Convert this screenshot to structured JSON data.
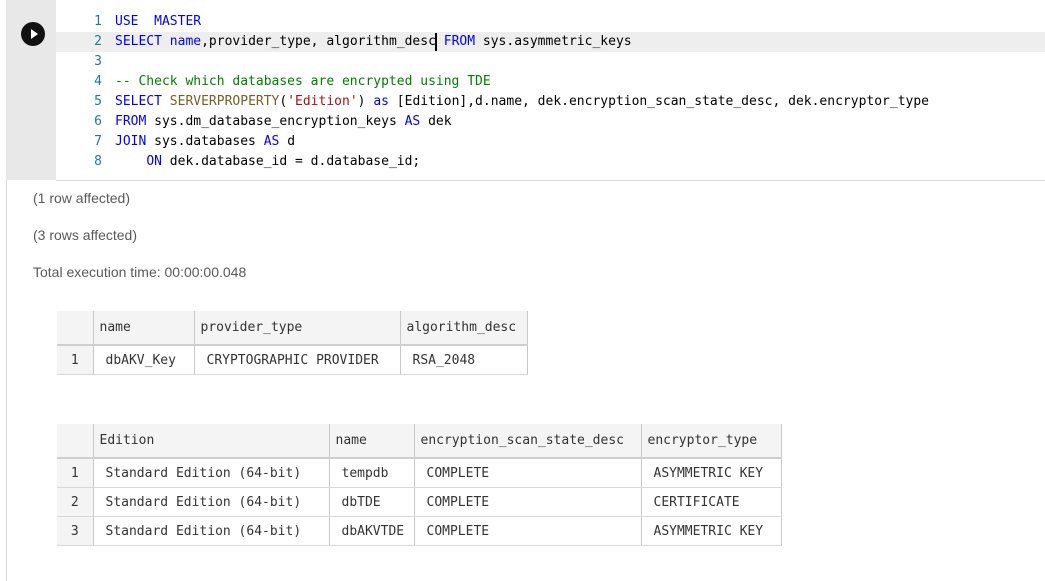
{
  "editor": {
    "lines": [
      {
        "num": "1",
        "parts": [
          [
            "kw",
            "USE"
          ],
          [
            "",
            "  "
          ],
          [
            "kw",
            "MASTER"
          ]
        ]
      },
      {
        "num": "2",
        "parts": [
          [
            "kw",
            "SELECT"
          ],
          [
            "",
            " "
          ],
          [
            "kw",
            "name"
          ],
          [
            "",
            ",provider_type, algorithm_desc"
          ],
          [
            "caret",
            ""
          ],
          [
            "",
            ""
          ],
          [
            "kw",
            " FROM"
          ],
          [
            "",
            " sys.asymmetric_keys"
          ]
        ]
      },
      {
        "num": "3",
        "parts": []
      },
      {
        "num": "4",
        "parts": [
          [
            "cm",
            "-- Check which databases are encrypted using TDE"
          ]
        ]
      },
      {
        "num": "5",
        "parts": [
          [
            "kw",
            "SELECT"
          ],
          [
            "",
            " "
          ],
          [
            "fn",
            "SERVERPROPERTY"
          ],
          [
            "",
            "("
          ],
          [
            "str",
            "'Edition'"
          ],
          [
            "",
            ") "
          ],
          [
            "kw",
            "as"
          ],
          [
            "",
            " [Edition],d.name, dek.encryption_scan_state_desc, dek.encryptor_type"
          ]
        ]
      },
      {
        "num": "6",
        "parts": [
          [
            "kw",
            "FROM"
          ],
          [
            "",
            " sys.dm_database_encryption_keys "
          ],
          [
            "kw",
            "AS"
          ],
          [
            "",
            " dek"
          ]
        ]
      },
      {
        "num": "7",
        "parts": [
          [
            "kw",
            "JOIN"
          ],
          [
            "",
            " sys.databases "
          ],
          [
            "kw",
            "AS"
          ],
          [
            "",
            " d"
          ]
        ]
      },
      {
        "num": "8",
        "parts": [
          [
            "",
            "    "
          ],
          [
            "kw",
            "ON"
          ],
          [
            "",
            " dek.database_id = d.database_id;"
          ]
        ]
      }
    ]
  },
  "messages": {
    "msg1": "(1 row affected)",
    "msg2": "(3 rows affected)",
    "exec_time": "Total execution time: 00:00:00.048"
  },
  "result1": {
    "columns": [
      "name",
      "provider_type",
      "algorithm_desc"
    ],
    "rows": [
      [
        "1",
        "dbAKV_Key",
        "CRYPTOGRAPHIC PROVIDER",
        "RSA_2048"
      ]
    ]
  },
  "result2": {
    "columns": [
      "Edition",
      "name",
      "encryption_scan_state_desc",
      "encryptor_type"
    ],
    "rows": [
      [
        "1",
        "Standard Edition (64-bit)",
        "tempdb",
        "COMPLETE",
        "ASYMMETRIC KEY"
      ],
      [
        "2",
        "Standard Edition (64-bit)",
        "dbTDE",
        "COMPLETE",
        "CERTIFICATE"
      ],
      [
        "3",
        "Standard Edition (64-bit)",
        "dbAKVTDE",
        "COMPLETE",
        "ASYMMETRIC KEY"
      ]
    ]
  }
}
